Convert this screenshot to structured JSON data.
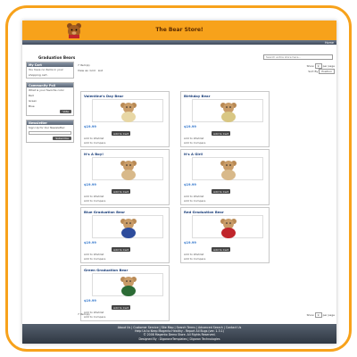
{
  "header": {
    "title": "The Bear Store!",
    "nav_right": "Home"
  },
  "category": {
    "title": "Graduation Bears",
    "search_placeholder": "Search entire store here..."
  },
  "sidebar": {
    "block1": {
      "title": "My Cart",
      "text1": "You have no items in your",
      "text2": "shopping cart."
    },
    "block2": {
      "title": "Community Poll",
      "question": "What is your favorite color",
      "options": [
        "Red",
        "Green",
        "Blue"
      ],
      "button": "Vote"
    },
    "block3": {
      "title": "Newsletter",
      "text": "Sign Up for Our Newsletter:",
      "button": "Subscribe"
    }
  },
  "toolbar_top": {
    "items": "7 Item(s)",
    "view_as": "View as: Grid",
    "list": "List",
    "show": "Show",
    "per_page_value": "9",
    "per_page": "per page",
    "sort_by": "Sort By",
    "sort_value": "Position"
  },
  "toolbar_bottom": {
    "items": "7 Item(s)",
    "show": "Show",
    "per_page_value": "9",
    "per_page": "per page"
  },
  "products": [
    {
      "name": "Valentine's Day Bear",
      "price": "$19.99",
      "cart": "Add to Cart",
      "wish": "Add to Wishlist",
      "compare": "Add to Compare",
      "color": "#e8d7a5"
    },
    {
      "name": "Birthday Bear",
      "price": "$19.99",
      "cart": "Add to Cart",
      "wish": "Add to Wishlist",
      "compare": "Add to Compare",
      "color": "#d9c784"
    },
    {
      "name": "It's A Boy!",
      "price": "$19.99",
      "cart": "Add to Cart",
      "wish": "Add to Wishlist",
      "compare": "Add to Compare",
      "color": "#d8b98a"
    },
    {
      "name": "It's A Girl!",
      "price": "$19.99",
      "cart": "Add to Cart",
      "wish": "Add to Wishlist",
      "compare": "Add to Compare",
      "color": "#d8b98a"
    },
    {
      "name": "Blue Graduation Bear",
      "price": "$19.99",
      "cart": "Add to Cart",
      "wish": "Add to Wishlist",
      "compare": "Add to Compare",
      "color": "#2d4c9c"
    },
    {
      "name": "Red Graduation Bear",
      "price": "$19.99",
      "cart": "Add to Cart",
      "wish": "Add to Wishlist",
      "compare": "Add to Compare",
      "color": "#c0252b"
    },
    {
      "name": "Green Graduation Bear",
      "price": "$19.99",
      "cart": "Add to Cart",
      "wish": "Add to Wishlist",
      "compare": "Add to Compare",
      "color": "#2b6b35"
    }
  ],
  "footer": {
    "line1": "About Us | Customer Service | Site Map | Search Terms | Advanced Search | Contact Us",
    "line2": "Help Us to Keep Magento Healthy - Report All Bugs (ver. 1.3.1)",
    "line3": "© 2008 Magento Demo Store. All Rights Reserved.",
    "line4": "Designed By : DigaroneTemplates | Digaron Technologies"
  },
  "colors": {
    "brand": "#f7a21b",
    "link": "#1b3f7a",
    "price": "#3377cc"
  }
}
